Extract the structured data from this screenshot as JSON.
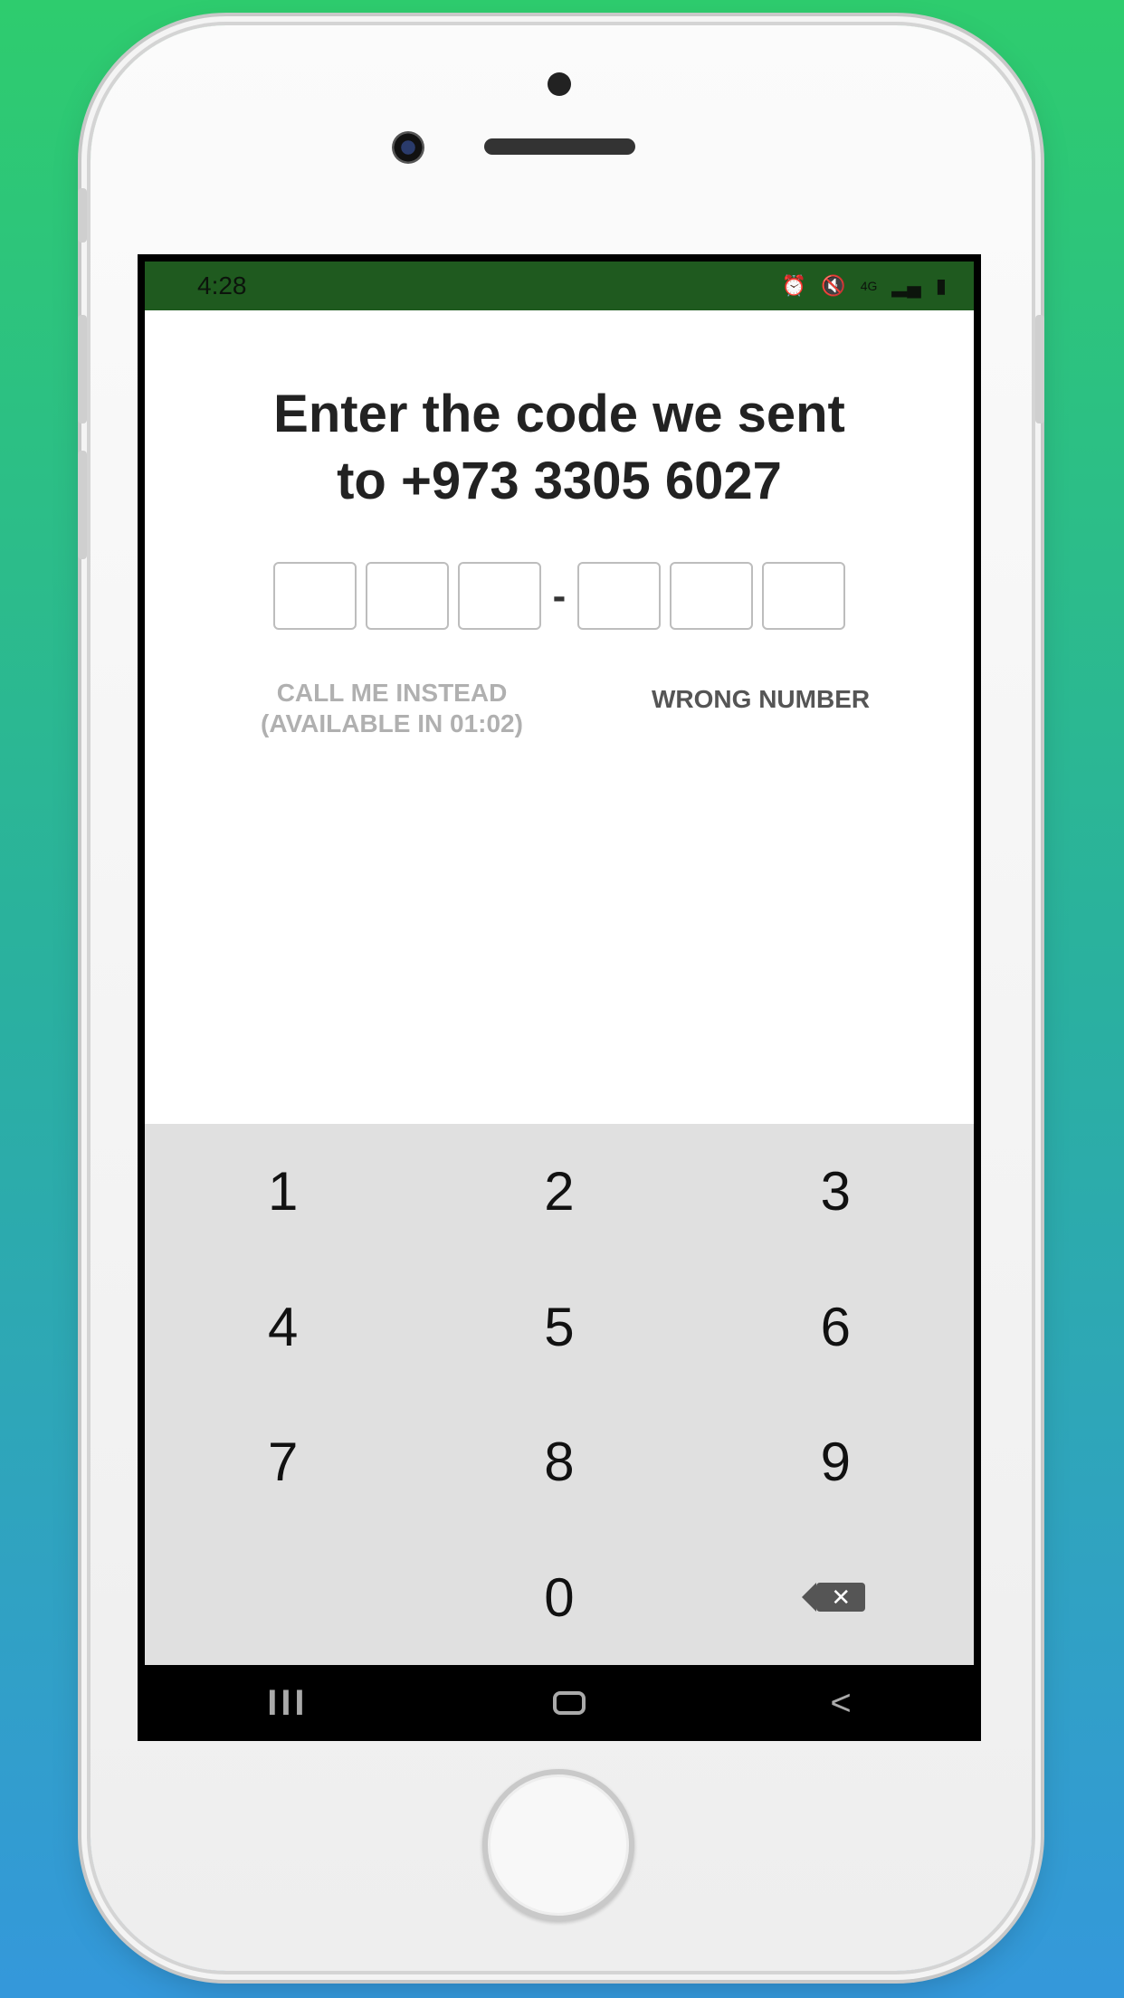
{
  "status_bar": {
    "time": "4:28",
    "icons": [
      "alarm-icon",
      "mute-icon",
      "4g-icon",
      "signal-icon",
      "battery-icon"
    ]
  },
  "verification": {
    "title_line1": "Enter the code we sent",
    "title_line2": "to +973 3305 6027",
    "code_separator": "-",
    "call_me_line1": "CALL ME INSTEAD",
    "call_me_line2": "(AVAILABLE IN 01:02)",
    "wrong_number": "WRONG NUMBER"
  },
  "keypad": {
    "keys": [
      "1",
      "2",
      "3",
      "4",
      "5",
      "6",
      "7",
      "8",
      "9",
      "",
      "0",
      "backspace"
    ]
  },
  "navbar": {
    "recents": "III",
    "back": "<"
  },
  "colors": {
    "status_bar": "#1f5a1f",
    "keypad_bg": "#e0e0e0",
    "background_top": "#2ecc6e",
    "background_bottom": "#3498db"
  }
}
